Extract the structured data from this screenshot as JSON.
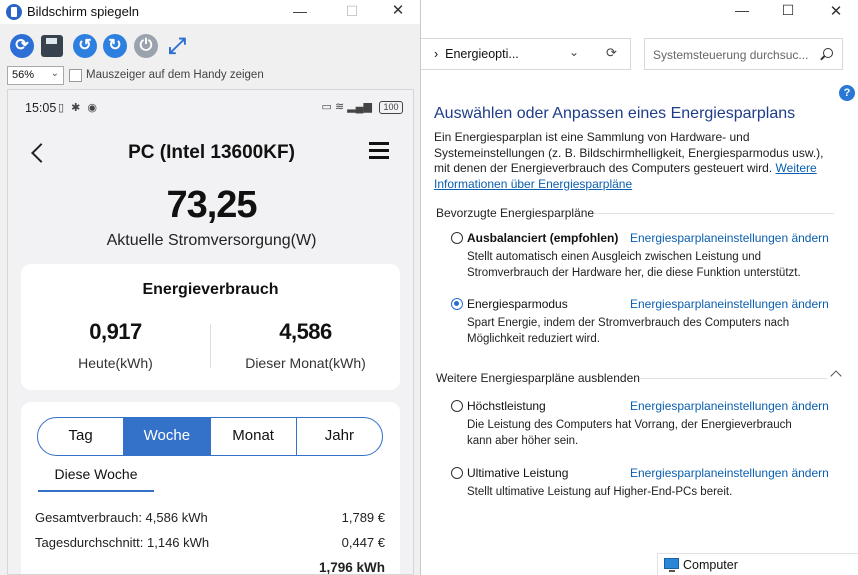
{
  "mirror": {
    "title": "Bildschirm spiegeln",
    "zoom": "56%",
    "show_pointer_label": "Mauszeiger auf dem Handy zeigen",
    "phone": {
      "time": "15:05",
      "battery": "100",
      "app_title": "PC (Intel 13600KF)",
      "current_power_value": "73,25",
      "current_power_label": "Aktuelle Stromversorgung(W)",
      "energy_card": {
        "title": "Energieverbrauch",
        "today_value": "0,917",
        "today_label": "Heute(kWh)",
        "month_value": "4,586",
        "month_label": "Dieser Monat(kWh)"
      },
      "period_tabs": [
        {
          "label": "Tag"
        },
        {
          "label": "Woche"
        },
        {
          "label": "Monat"
        },
        {
          "label": "Jahr"
        }
      ],
      "active_tab": "Woche",
      "subtab": "Diese Woche",
      "rows": [
        {
          "label": "Gesamtverbrauch: 4,586 kWh",
          "value": "1,789 €"
        },
        {
          "label": "Tagesdurchschnitt: 1,146 kWh",
          "value": "0,447 €"
        }
      ],
      "partial_value": "1,796 kWh"
    }
  },
  "control_panel": {
    "address": "Energieopti...",
    "search_placeholder": "Systemsteuerung durchsuc...",
    "heading": "Auswählen oder Anpassen eines Energiesparplans",
    "description": "Ein Energiesparplan ist eine Sammlung von Hardware- und Systemeinstellungen (z. B. Bildschirmhelligkeit, Energiesparmodus usw.), mit denen der Energieverbrauch des Computers gesteuert wird.",
    "description_link": "Weitere Informationen über Energiesparpläne",
    "preferred_group": "Bevorzugte Energiesparpläne",
    "hidden_group": "Weitere Energiesparpläne ausblenden",
    "change_link": "Energiesparplaneinstellungen ändern",
    "plans": [
      {
        "name": "Ausbalanciert (empfohlen)",
        "desc": "Stellt automatisch einen Ausgleich zwischen Leistung und Stromverbrauch der Hardware her, die diese Funktion unterstützt."
      },
      {
        "name": "Energiesparmodus",
        "desc": "Spart Energie, indem der Stromverbrauch des Computers nach Möglichkeit reduziert wird."
      },
      {
        "name": "Höchstleistung",
        "desc": "Die Leistung des Computers hat Vorrang, der Energieverbrauch kann aber höher sein."
      },
      {
        "name": "Ultimative Leistung",
        "desc": "Stellt ultimative Leistung auf Higher-End-PCs bereit."
      }
    ],
    "selected_plan": "Energiesparmodus",
    "statusbar": "Computer"
  }
}
